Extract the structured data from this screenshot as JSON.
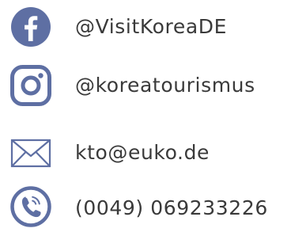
{
  "colors": {
    "icon": "#5e6fa3",
    "text": "#3a3a3a"
  },
  "contacts": [
    {
      "icon": "facebook-icon",
      "text": "@VisitKoreaDE"
    },
    {
      "icon": "instagram-icon",
      "text": "@koreatourismus"
    },
    {
      "icon": "mail-icon",
      "text": "kto@euko.de"
    },
    {
      "icon": "phone-icon",
      "text": "(0049) 069233226"
    }
  ]
}
